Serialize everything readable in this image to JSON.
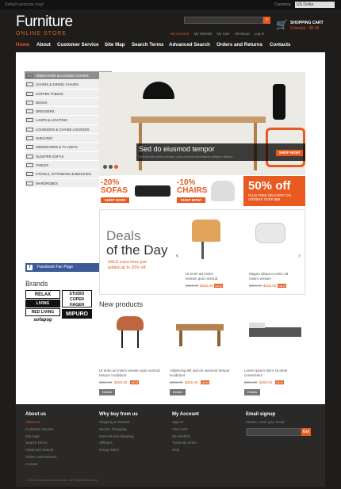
{
  "topbar": {
    "welcome": "Default welcome msg!",
    "currency_label": "Currency:",
    "currency_value": "US Dollar"
  },
  "header": {
    "logo_main": "Furniture",
    "logo_sub": "ONLINE STORE",
    "search_placeholder": "",
    "links": [
      "My Account",
      "My Wishlist",
      "My Cart",
      "Checkout",
      "Log In"
    ],
    "cart_title": "SHOPPING CART",
    "cart_summary": "0 item(s) - $0.00"
  },
  "nav": [
    "Home",
    "About",
    "Customer Service",
    "Site Map",
    "Search Terms",
    "Advanced Search",
    "Orders and Returns",
    "Contacts"
  ],
  "categories": [
    "ARMCHAIRS & LOUNGE CHAIRS",
    "CHAIRS & DINING CHAIRS",
    "COFFEE TABLES",
    "DESKS",
    "DRESSERS",
    "LAMPS & LIGHTING",
    "LOUNGERS & CHAISE LOUNGES",
    "SHELVING",
    "SIDEBOARDS & TV UNITS",
    "SLEEPER SOFAS",
    "TABLES",
    "STOOLS, OTTOMANS & BENCHES",
    "WARDROBES"
  ],
  "facebook": "Facebook Fan Page",
  "brands": {
    "title": "Brands",
    "items": [
      "RELAX",
      "STUDIO COPEN HAGEN",
      "LIVING",
      "RED LIVING",
      "sofapop",
      "MIPURO"
    ]
  },
  "slider": {
    "caption": "Sed do eiusmod tempor",
    "sub": "Ut enim ad minim veniam, quis nostrud exercitation ullamco laboris",
    "button": "SHOP NOW!"
  },
  "promos": [
    {
      "pct": "-20%",
      "name": "SOFAS",
      "button": "SHOP NOW!"
    },
    {
      "pct": "-10%",
      "name": "CHAIRS",
      "button": "SHOP NOW!"
    }
  ],
  "promo_big": {
    "title": "50% off",
    "text": "PLUS FREE DELIVERY ON ORDERS OVER $99"
  },
  "deals": {
    "line1": "Deals",
    "line2": "of the Day",
    "line3": "SALE extra lines just added up to 20% off",
    "products": [
      {
        "name": "Ut enim ad minim veniam quis nostrud",
        "old": "$359.00",
        "new": "$259.00",
        "tag": "NEW"
      },
      {
        "name": "Magna aliqua ut enim ad minim veniam",
        "old": "$359.00",
        "new": "$259.00",
        "tag": "NEW"
      }
    ]
  },
  "new_products": {
    "title": "New products",
    "items": [
      {
        "name": "Ut enim ad minim veniam quis nostrud tempor incididunt",
        "old": "$359.00",
        "new": "$259.00",
        "tag": "NEW",
        "details": "Details"
      },
      {
        "name": "Adipiscing elit sed do eiusmod tempor incididunt",
        "old": "$359.00",
        "new": "$259.00",
        "tag": "NEW",
        "details": "Details"
      },
      {
        "name": "Lorem ipsum dolor sit amet consectetur",
        "old": "$359.00",
        "new": "$259.00",
        "tag": "NEW",
        "details": "Details"
      }
    ]
  },
  "footer": {
    "col1": {
      "title": "About us",
      "links": [
        "About Us",
        "Customer Service",
        "Site Map",
        "Search Terms",
        "Advanced Search",
        "Orders and Returns",
        "Contact"
      ]
    },
    "col2": {
      "title": "Why buy from us",
      "links": [
        "Shipping & Returns",
        "Secure Shopping",
        "International Shipping",
        "Affiliates",
        "Group Sales"
      ]
    },
    "col3": {
      "title": "My Account",
      "links": [
        "Sign In",
        "View Cart",
        "My Wishlist",
        "Track My Order",
        "Help"
      ]
    },
    "col4": {
      "title": "Email signup",
      "text": "Please, enter your email",
      "button": "Go!"
    },
    "copyright": "© 2012 Magento Demo Store. All Rights Reserved."
  }
}
